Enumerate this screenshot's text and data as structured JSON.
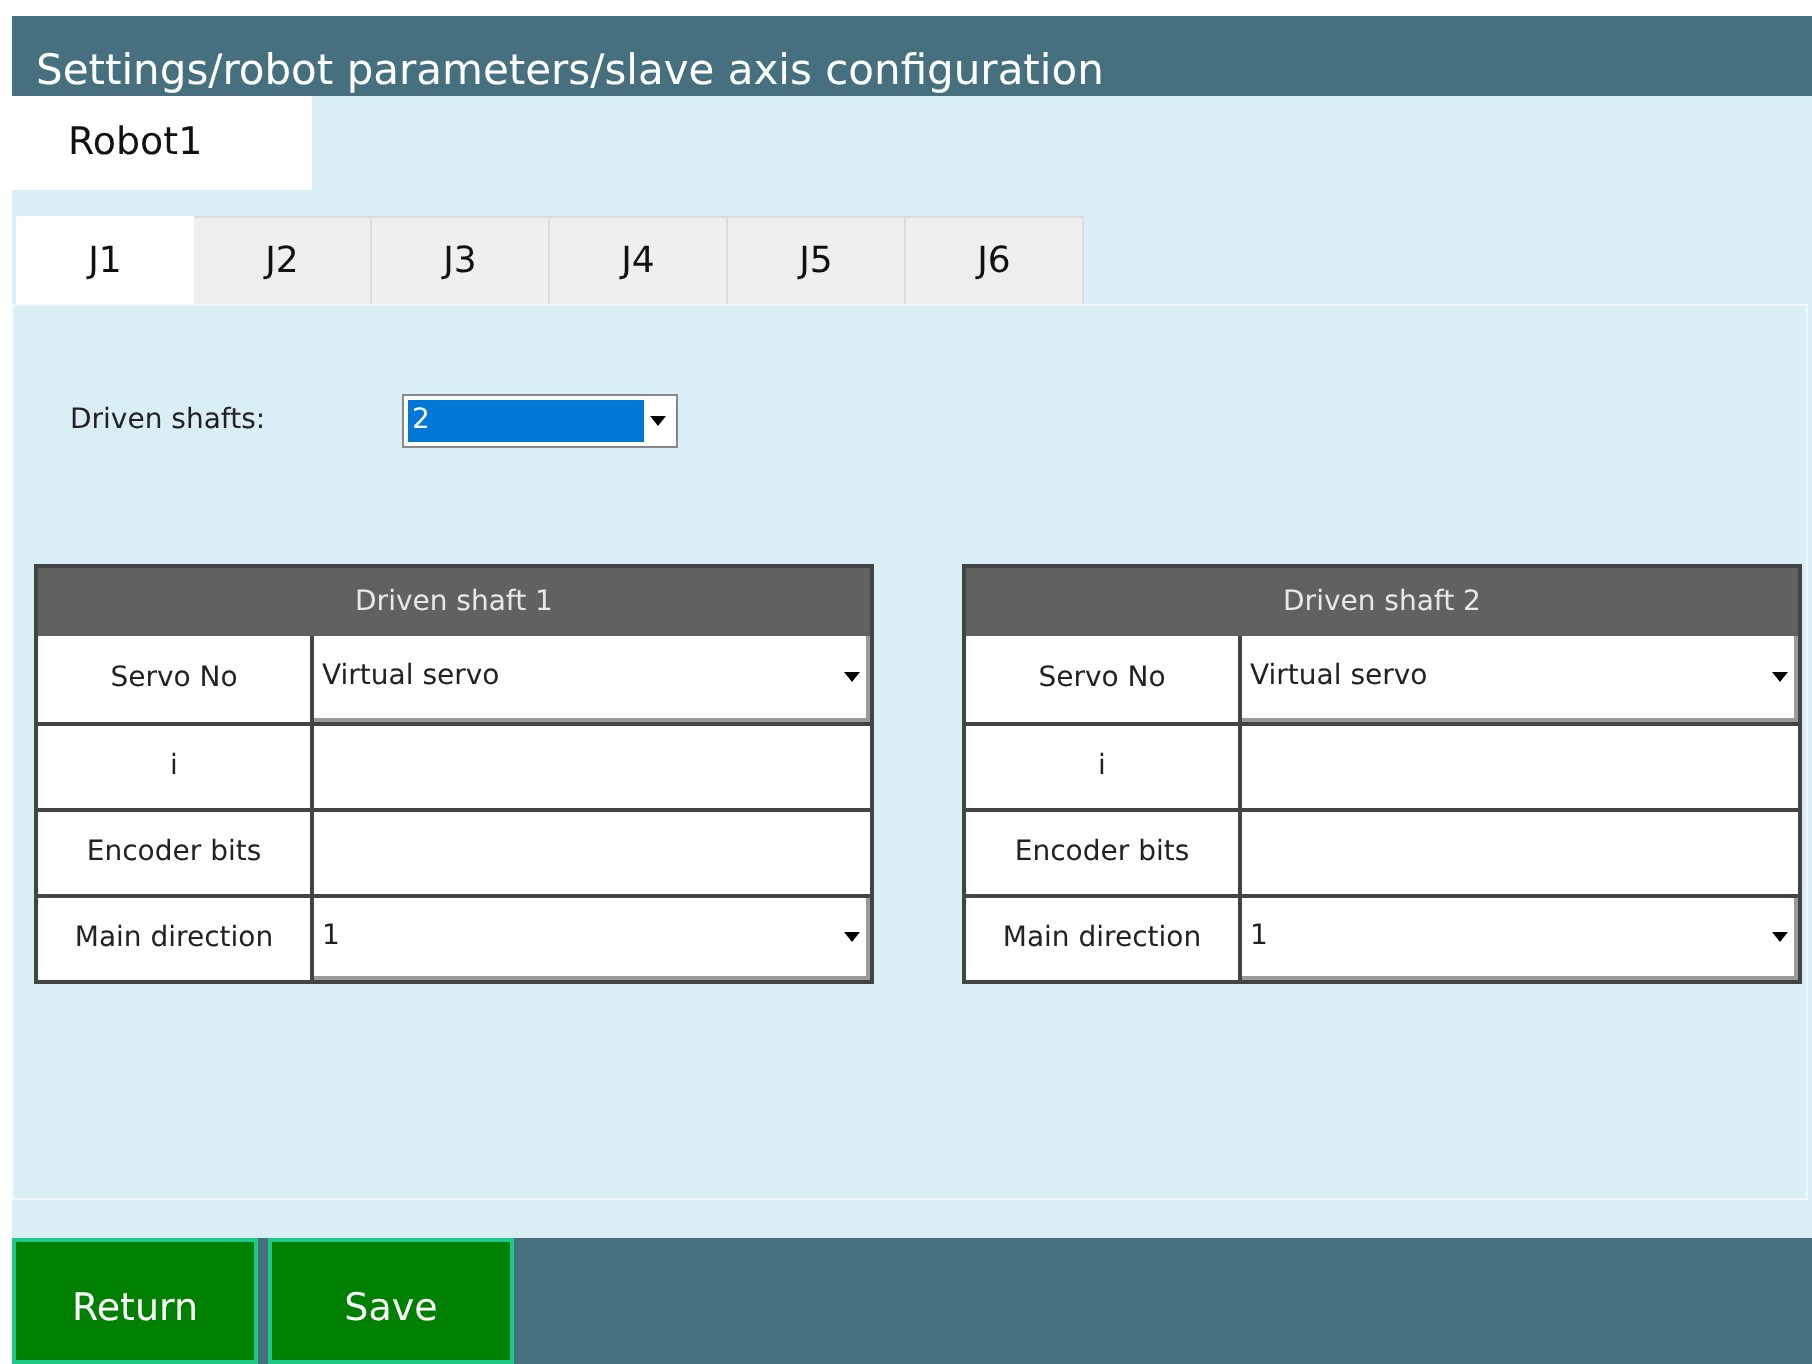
{
  "window": {
    "title": "Settings/robot parameters/slave axis configuration"
  },
  "robot_tabs": [
    {
      "label": "Robot1",
      "selected": true
    }
  ],
  "joint_tabs": [
    {
      "label": "J1",
      "selected": true
    },
    {
      "label": "J2",
      "selected": false
    },
    {
      "label": "J3",
      "selected": false
    },
    {
      "label": "J4",
      "selected": false
    },
    {
      "label": "J5",
      "selected": false
    },
    {
      "label": "J6",
      "selected": false
    }
  ],
  "driven_shafts": {
    "label": "Driven shafts:",
    "value": "2"
  },
  "shafts": [
    {
      "title": "Driven shaft 1",
      "rows": [
        {
          "label": "Servo No",
          "kind": "dropdown",
          "value": "Virtual servo"
        },
        {
          "label": "i",
          "kind": "text"
        },
        {
          "label": "Encoder bits",
          "kind": "text"
        },
        {
          "label": "Main direction",
          "kind": "dropdown",
          "value": "1"
        }
      ]
    },
    {
      "title": "Driven shaft 2",
      "rows": [
        {
          "label": "Servo No",
          "kind": "dropdown",
          "value": "Virtual servo"
        },
        {
          "label": "i",
          "kind": "text"
        },
        {
          "label": "Encoder bits",
          "kind": "text"
        },
        {
          "label": "Main direction",
          "kind": "dropdown",
          "value": "1"
        }
      ]
    }
  ],
  "buttons": [
    "Return",
    "Save"
  ]
}
